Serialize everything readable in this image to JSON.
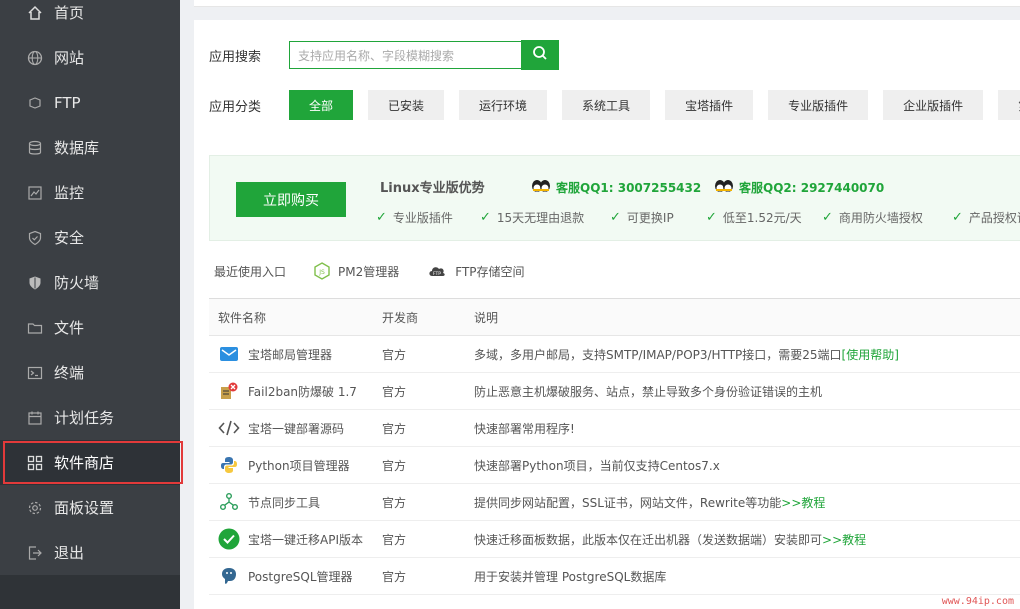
{
  "sidebar": {
    "items": [
      {
        "label": "首页",
        "icon": "home-icon"
      },
      {
        "label": "网站",
        "icon": "globe-icon"
      },
      {
        "label": "FTP",
        "icon": "ftp-icon"
      },
      {
        "label": "数据库",
        "icon": "database-icon"
      },
      {
        "label": "监控",
        "icon": "monitor-icon"
      },
      {
        "label": "安全",
        "icon": "shield-icon"
      },
      {
        "label": "防火墙",
        "icon": "firewall-icon"
      },
      {
        "label": "文件",
        "icon": "folder-icon"
      },
      {
        "label": "终端",
        "icon": "terminal-icon"
      },
      {
        "label": "计划任务",
        "icon": "calendar-icon"
      },
      {
        "label": "软件商店",
        "icon": "grid-icon",
        "active": true
      },
      {
        "label": "面板设置",
        "icon": "gear-icon"
      },
      {
        "label": "退出",
        "icon": "logout-icon"
      }
    ]
  },
  "search": {
    "label": "应用搜索",
    "placeholder": "支持应用名称、字段模糊搜索"
  },
  "categories": {
    "label": "应用分类",
    "items": [
      "全部",
      "已安装",
      "运行环境",
      "系统工具",
      "宝塔插件",
      "专业版插件",
      "企业版插件",
      "第"
    ],
    "active": 0
  },
  "promo": {
    "buy_label": "立即购买",
    "title": "Linux专业版优势",
    "qq1": "客服QQ1: 3007255432",
    "qq2": "客服QQ2: 2927440070",
    "features": [
      "专业版插件",
      "15天无理由退款",
      "可更换IP",
      "低至1.52元/天",
      "商用防火墙授权",
      "产品授权证"
    ]
  },
  "recent": {
    "label": "最近使用入口",
    "items": [
      "PM2管理器",
      "FTP存储空间"
    ]
  },
  "table": {
    "headers": [
      "软件名称",
      "开发商",
      "说明"
    ],
    "rows": [
      {
        "name": "宝塔邮局管理器",
        "dev": "官方",
        "desc": "多域，多用户邮局，支持SMTP/IMAP/POP3/HTTP接口，需要25端口",
        "link": "[使用帮助]",
        "icon": "mail-icon"
      },
      {
        "name": "Fail2ban防爆破 1.7",
        "dev": "官方",
        "desc": "防止恶意主机爆破服务、站点，禁止导致多个身份验证错误的主机",
        "link": "",
        "icon": "fail2ban-icon"
      },
      {
        "name": "宝塔一键部署源码",
        "dev": "官方",
        "desc": "快速部署常用程序!",
        "link": "",
        "icon": "code-icon"
      },
      {
        "name": "Python项目管理器",
        "dev": "官方",
        "desc": "快速部署Python项目，当前仅支持Centos7.x",
        "link": "",
        "icon": "python-icon"
      },
      {
        "name": "节点同步工具",
        "dev": "官方",
        "desc": "提供同步网站配置，SSL证书，网站文件，Rewrite等功能",
        "link": ">>教程",
        "icon": "nodes-icon"
      },
      {
        "name": "宝塔一键迁移API版本",
        "dev": "官方",
        "desc": "快速迁移面板数据，此版本仅在迁出机器（发送数据端）安装即可",
        "link": ">>教程",
        "icon": "check-circle-icon"
      },
      {
        "name": "PostgreSQL管理器",
        "dev": "官方",
        "desc": "用于安装并管理 PostgreSQL数据库",
        "link": "",
        "icon": "postgresql-icon"
      }
    ]
  },
  "watermark": "www.94ip.com"
}
